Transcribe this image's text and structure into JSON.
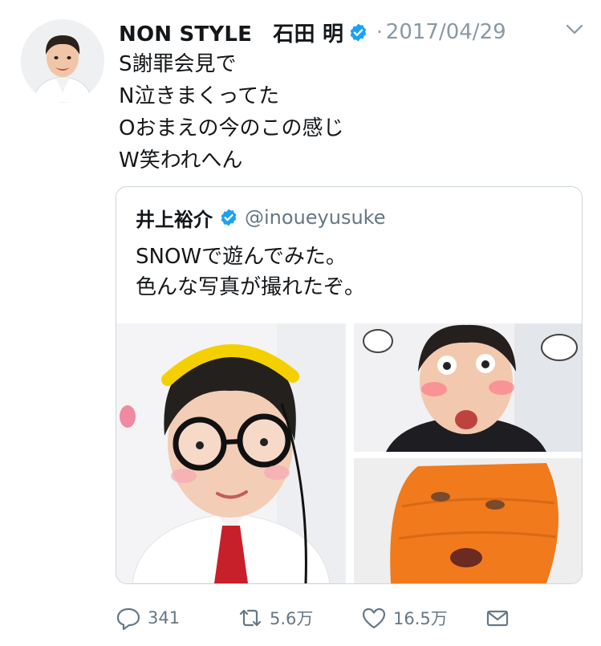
{
  "tweet": {
    "display_name": "NON STYLE　石田 明",
    "separator": "·",
    "date": "2017/04/29",
    "lines": [
      "S謝罪会見で",
      "N泣きまくってた",
      "Oおまえの今のこの感じ",
      "W笑われへん"
    ]
  },
  "quote": {
    "display_name": "井上裕介",
    "handle": "@inoueyusuke",
    "lines": [
      "SNOWで遊んでみた。",
      "色んな写真が撮れたぞ。"
    ]
  },
  "actions": {
    "replies": "341",
    "retweets": "5.6万",
    "likes": "16.5万"
  },
  "colors": {
    "verified": "#1da1f2",
    "muted": "#657786",
    "border": "#ccd6dd"
  }
}
